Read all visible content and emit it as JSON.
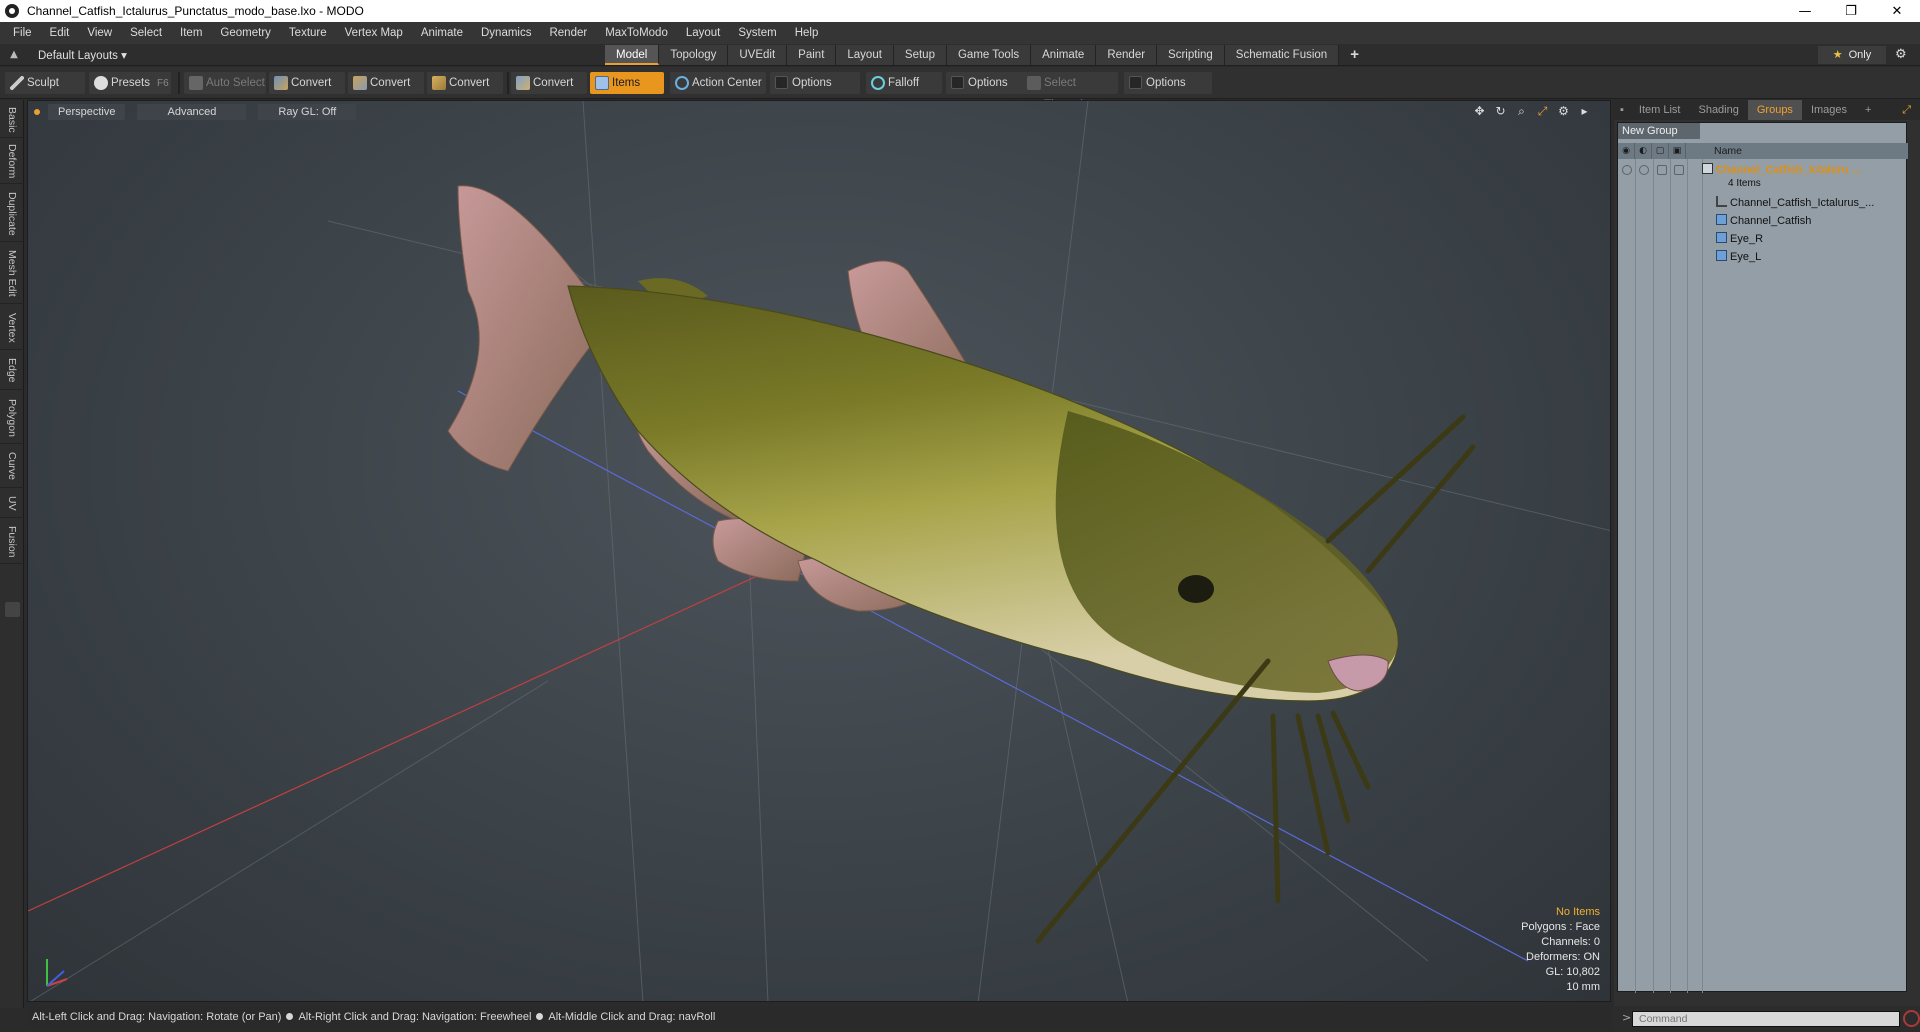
{
  "window": {
    "title": "Channel_Catfish_Ictalurus_Punctatus_modo_base.lxo - MODO",
    "minimize": "—",
    "restore": "❐",
    "close": "✕"
  },
  "menu": [
    "File",
    "Edit",
    "View",
    "Select",
    "Item",
    "Geometry",
    "Texture",
    "Vertex Map",
    "Animate",
    "Dynamics",
    "Render",
    "MaxToModo",
    "Layout",
    "System",
    "Help"
  ],
  "layoutbar": {
    "layout_dropdown": "Default Layouts ▾",
    "tabs": [
      "Model",
      "Topology",
      "UVEdit",
      "Paint",
      "Layout",
      "Setup",
      "Game Tools",
      "Animate",
      "Render",
      "Scripting",
      "Schematic Fusion"
    ],
    "active_tab": "Model",
    "plus": "+",
    "only_label": "Only"
  },
  "toolbar": {
    "sculpt": "Sculpt",
    "presets": "Presets",
    "presets_hotkey": "F6",
    "auto_select": "Auto Select",
    "convert1": "Convert",
    "convert2": "Convert",
    "convert3": "Convert",
    "convert4": "Convert",
    "items": "Items",
    "action_center": "Action Center",
    "options1": "Options",
    "falloff": "Falloff",
    "options2": "Options",
    "select_through": "Select Through",
    "options3": "Options"
  },
  "left_tabs": [
    "Basic",
    "Deform",
    "Duplicate",
    "Mesh Edit",
    "Vertex",
    "Edge",
    "Polygon",
    "Curve",
    "UV",
    "Fusion"
  ],
  "viewport": {
    "perspective": "Perspective",
    "advanced": "Advanced",
    "raygl": "Ray GL: Off",
    "info": {
      "items": "No Items",
      "polygons": "Polygons : Face",
      "channels": "Channels: 0",
      "deformers": "Deformers: ON",
      "gl": "GL: 10,802",
      "scale": "10 mm"
    }
  },
  "statusbar": {
    "hint1": "Alt-Left Click and Drag: Navigation: Rotate (or Pan)",
    "hint2": "Alt-Right Click and Drag: Navigation: Freewheel",
    "hint3": "Alt-Middle Click and Drag: navRoll"
  },
  "right_panel": {
    "tabs": [
      "Item List",
      "Shading",
      "Groups",
      "Images",
      "+"
    ],
    "active_tab": "Groups",
    "new_group": "New Group",
    "col_name": "Name",
    "group_name": "Channel_Catfish_Ictaluru ...",
    "group_count": "4 Items",
    "items": [
      "Channel_Catfish_Ictalurus_...",
      "Channel_Catfish",
      "Eye_R",
      "Eye_L"
    ],
    "command_placeholder": "Command"
  },
  "colors": {
    "accent": "#e8961e",
    "group_text": "#e09010",
    "info_highlight": "#f0b030"
  }
}
